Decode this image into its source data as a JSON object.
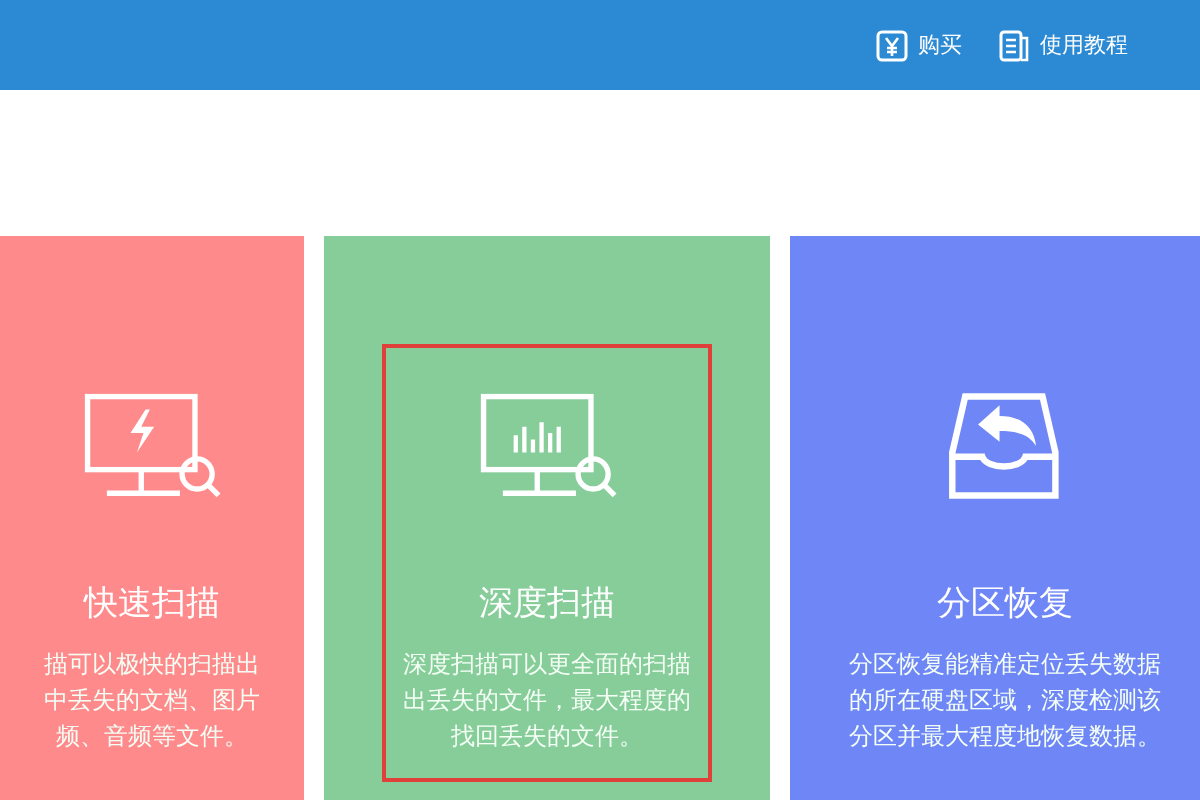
{
  "header": {
    "links": [
      {
        "kind": "buy",
        "label": "购买"
      },
      {
        "kind": "tutorial",
        "label": "使用教程"
      }
    ]
  },
  "cards": [
    {
      "kind": "quick",
      "title": "快速扫描",
      "description": [
        "描可以极快的扫描出",
        "中丢失的文档、图片",
        "频、音频等文件。"
      ],
      "color": "#ff8a8c",
      "selected": false
    },
    {
      "kind": "deep",
      "title": "深度扫描",
      "description": [
        "深度扫描可以更全面的扫描",
        "出丢失的文件，最大程度的",
        "找回丢失的文件。"
      ],
      "color": "#87cd99",
      "selected": true
    },
    {
      "kind": "partition",
      "title": "分区恢复",
      "description": [
        "分区恢复能精准定位丢失数据",
        "的所在硬盘区域，深度检测该",
        "分区并最大程度地恢复数据。"
      ],
      "color": "#6f86f6",
      "selected": false
    }
  ]
}
